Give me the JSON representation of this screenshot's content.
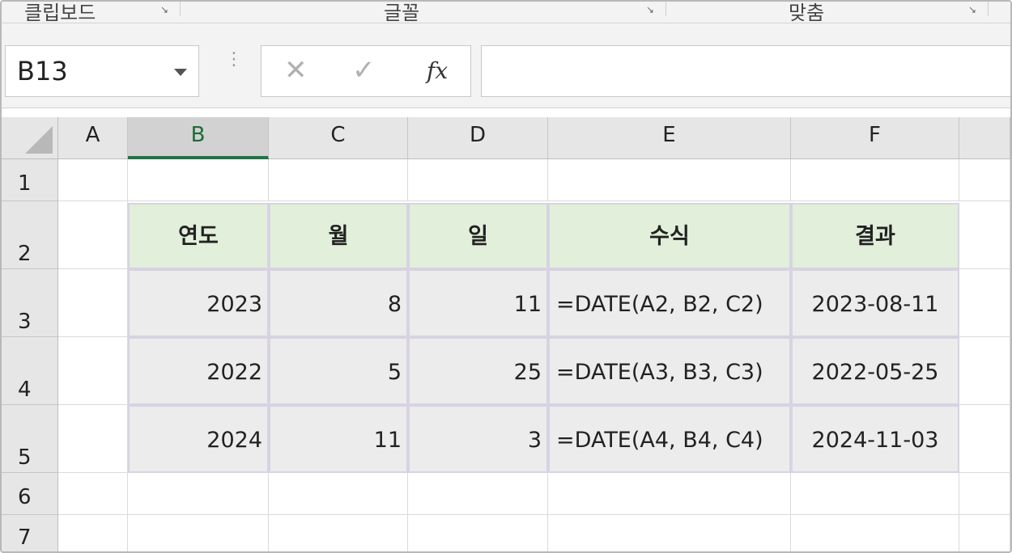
{
  "ribbon": {
    "groups": [
      "클립보드",
      "글꼴",
      "맞춤"
    ]
  },
  "formula_bar": {
    "name_box": "B13",
    "cancel_icon": "✕",
    "enter_icon": "✓",
    "fx_label": "fx",
    "formula": ""
  },
  "sheet": {
    "columns": [
      "A",
      "B",
      "C",
      "D",
      "E",
      "F"
    ],
    "selected_column": "B",
    "rows": [
      "1",
      "2",
      "3",
      "4",
      "5",
      "6",
      "7"
    ],
    "table": {
      "headers": [
        "연도",
        "월",
        "일",
        "수식",
        "결과"
      ],
      "rows": [
        [
          "2023",
          "8",
          "11",
          "=DATE(A2, B2, C2)",
          "2023-08-11"
        ],
        [
          "2022",
          "5",
          "25",
          "=DATE(A3, B3, C3)",
          "2022-05-25"
        ],
        [
          "2024",
          "11",
          "3",
          "=DATE(A4, B4, C4)",
          "2024-11-03"
        ]
      ]
    }
  },
  "colors": {
    "header_fill": "#e2efda",
    "data_fill": "#ececec",
    "selection_accent": "#217346"
  }
}
